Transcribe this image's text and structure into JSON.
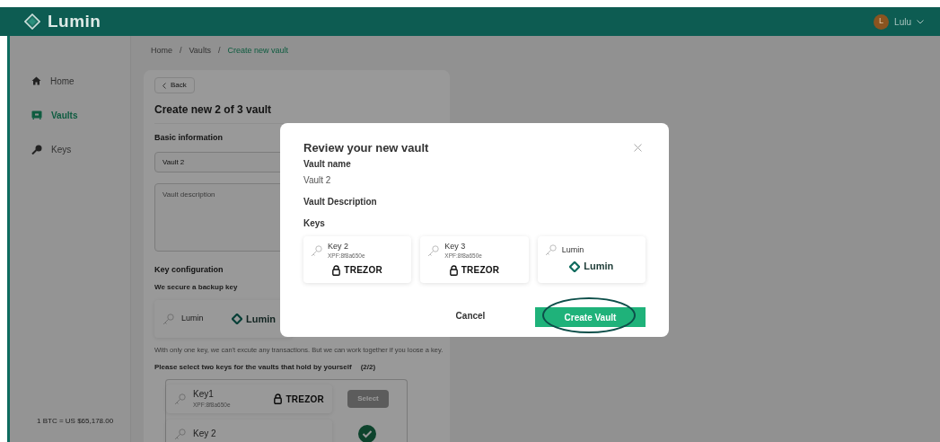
{
  "header": {
    "logo": "Lumin",
    "user": {
      "initial": "L",
      "name": "Lulu"
    }
  },
  "sidebar": {
    "items": [
      {
        "label": "Home",
        "selected": false
      },
      {
        "label": "Vaults",
        "selected": true
      },
      {
        "label": "Keys",
        "selected": false
      }
    ],
    "rate": "1 BTC = US $65,178.00"
  },
  "breadcrumb": [
    {
      "kind": "link",
      "label": "Home"
    },
    {
      "kind": "separator",
      "label": "/"
    },
    {
      "kind": "link",
      "label": "Vaults"
    },
    {
      "kind": "separator",
      "label": "/"
    },
    {
      "kind": "current",
      "label": "Create new vault"
    }
  ],
  "form": {
    "back_button": "Back",
    "title": "Create new 2 of 3 vault",
    "basic_heading": "Basic information",
    "name_value": "Vault 2",
    "description_placeholder": "Vault description",
    "key_heading": "Key configuration",
    "backup_label": "We secure a backup key",
    "backup_key": {
      "name": "Lumin",
      "brand": "Lumin",
      "kind": "lumin"
    },
    "note": "With only one key, we can't excute any transactions. But we can work together if you loose a key.",
    "select_prompt": "Please select two keys for the vaults that hold by yourself",
    "select_count": "(2/2)",
    "keys": [
      {
        "name": "Key1",
        "xpf": "XPF:8f8a650e",
        "brand": "TREZOR",
        "selected": false,
        "button": "Select"
      },
      {
        "name": "Key 2",
        "selected": true
      }
    ]
  },
  "modal": {
    "title": "Review your new vault",
    "fields": [
      {
        "label": "Vault name",
        "value": "Vault 2"
      },
      {
        "label": "Vault Description"
      },
      {
        "label": "Keys"
      }
    ],
    "keys": [
      {
        "name": "Key 2",
        "xpf": "XPF:8f8a650e",
        "brand": "TREZOR",
        "kind": "trezor"
      },
      {
        "name": "Key 3",
        "xpf": "XPF:8f8a650e",
        "brand": "TREZOR",
        "kind": "trezor"
      },
      {
        "name": "Lumin",
        "brand": "Lumin",
        "kind": "lumin"
      }
    ],
    "cancel": "Cancel",
    "create": "Create Vault",
    "create_highlighted": true
  }
}
